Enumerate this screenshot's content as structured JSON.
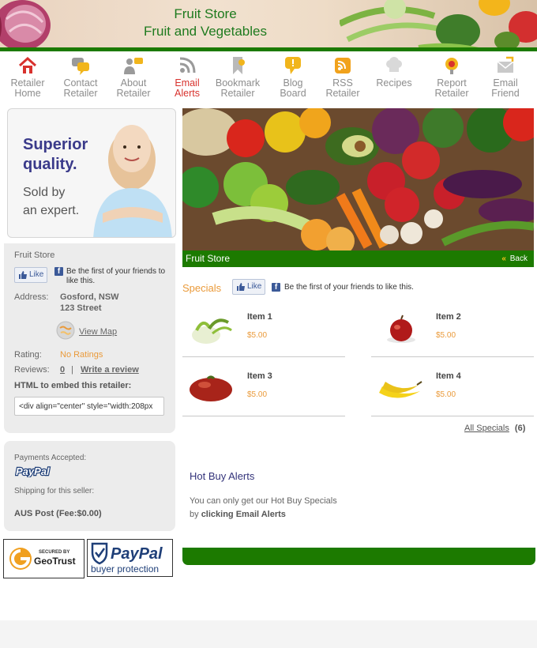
{
  "header": {
    "store_name": "Fruit Store",
    "tagline": "Fruit and Vegetables"
  },
  "nav": [
    {
      "line1": "Retailer",
      "line2": "Home",
      "icon": "home-icon"
    },
    {
      "line1": "Contact",
      "line2": "Retailer",
      "icon": "chat-bubbles-icon"
    },
    {
      "line1": "About",
      "line2": "Retailer",
      "icon": "users-icon"
    },
    {
      "line1": "Email",
      "line2": "Alerts",
      "icon": "rss-alert-icon",
      "active": true
    },
    {
      "line1": "Bookmark",
      "line2": "Retailer",
      "icon": "bookmark-icon"
    },
    {
      "line1": "Blog",
      "line2": "Board",
      "icon": "speech-bubble-icon"
    },
    {
      "line1": "RSS",
      "line2": "Retailer",
      "icon": "rss-icon"
    },
    {
      "line1": "Recipes",
      "line2": "",
      "icon": "chef-hat-icon"
    },
    {
      "line1": "Report",
      "line2": "Retailer",
      "icon": "alert-beacon-icon"
    },
    {
      "line1": "Email",
      "line2": "Friend",
      "icon": "envelope-icon"
    }
  ],
  "promo": {
    "headline_1": "Superior",
    "headline_2": "quality.",
    "sub_1": "Sold by",
    "sub_2": "an expert."
  },
  "retailer": {
    "name": "Fruit Store",
    "like_label": "Like",
    "friends_text_1": "Be the first of your friends to",
    "friends_text_2": "like this.",
    "address_label": "Address:",
    "address_line_1": "Gosford, NSW",
    "address_line_2": "123 Street",
    "view_map": "View Map",
    "rating_label": "Rating:",
    "rating_value": "No Ratings",
    "reviews_label": "Reviews:",
    "reviews_count": "0",
    "reviews_sep": "|",
    "write_review": "Write a review",
    "embed_label": "HTML to embed this retailer:",
    "embed_value": "<div align=\"center\" style=\"width:208px"
  },
  "payment": {
    "accepted_label": "Payments Accepted:",
    "paypal_logo": "PayPal",
    "shipping_label": "Shipping for this seller:",
    "shipping_value": "AUS Post (Fee:$0.00)"
  },
  "badges": {
    "geotrust_secured": "SECURED BY",
    "geotrust_name": "GeoTrust",
    "paypal_name": "PayPal",
    "paypal_sub": "buyer protection"
  },
  "hero": {
    "title": "Fruit Store",
    "back_chevron": "«",
    "back_label": "Back"
  },
  "specials": {
    "title": "Specials",
    "like_label": "Like",
    "friends_text": "Be the first of your friends to like this.",
    "items": [
      {
        "name": "Item 1",
        "price": "$5.00",
        "icon": "fennel-icon"
      },
      {
        "name": "Item 2",
        "price": "$5.00",
        "icon": "apple-icon"
      },
      {
        "name": "Item 3",
        "price": "$5.00",
        "icon": "tomato-icon"
      },
      {
        "name": "Item 4",
        "price": "$5.00",
        "icon": "banana-icon"
      }
    ],
    "all_label": "All Specials",
    "all_count": "(6)"
  },
  "hot_buy": {
    "title": "Hot Buy Alerts",
    "desc_1": "You can only get our Hot Buy Specials",
    "desc_2_prefix": "by",
    "desc_2_bold": "clicking Email Alerts"
  },
  "colors": {
    "brand_green": "#1c7a00",
    "accent_orange": "#ea9a3a",
    "active_red": "#d8322e",
    "heading_navy": "#33337a"
  }
}
